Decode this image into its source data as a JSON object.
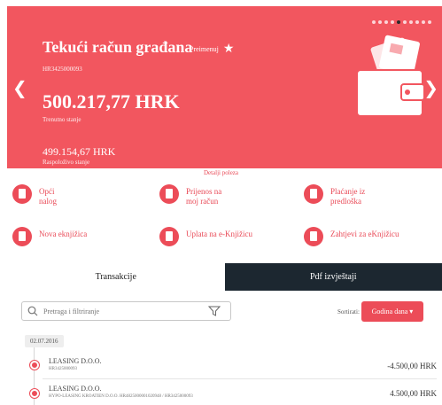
{
  "hero": {
    "title": "Tekući račun građana",
    "rename_label": "Preimenuj",
    "iban": "HR3425000093",
    "balance": "500.217,77 HRK",
    "balance_label": "Trenutno stanje",
    "available": "499.154,67 HRK",
    "available_label": "Raspoloživo stanje",
    "carousel_pages": 10,
    "carousel_active": 4,
    "accent_color": "#f2565f"
  },
  "details_link": "Detalji poleza",
  "actions": [
    {
      "label": "Opći\nnalog",
      "icon": "document-icon"
    },
    {
      "label": "Prijenos na\nmoj račun",
      "icon": "transfer-icon"
    },
    {
      "label": "Plaćanje iz\npredloška",
      "icon": "template-icon"
    },
    {
      "label": "Nova eknjižica",
      "icon": "booklet-icon"
    },
    {
      "label": "Uplata na e-Knjižicu",
      "icon": "deposit-icon"
    },
    {
      "label": "Zahtjevi za eKnjižicu",
      "icon": "request-icon"
    }
  ],
  "tabs": [
    {
      "label": "Transakcije"
    },
    {
      "label": "Pdf izvještaji"
    }
  ],
  "search": {
    "placeholder": "Pretraga i filtriranje"
  },
  "sort": {
    "label": "Sortirati:",
    "value": "Godina dana ▾"
  },
  "transactions": {
    "date": "02.07.2016",
    "items": [
      {
        "name": "LEASING D.O.O.",
        "sub": "HR3425000093",
        "amount": "-4.500,00 HRK"
      },
      {
        "name": "LEASING D.O.O.",
        "sub": "HYPO-LEASING KROATIEN D.O.O.  HR4825000001020948 / HR3425000093",
        "amount": "4.500,00 HRK"
      }
    ]
  }
}
